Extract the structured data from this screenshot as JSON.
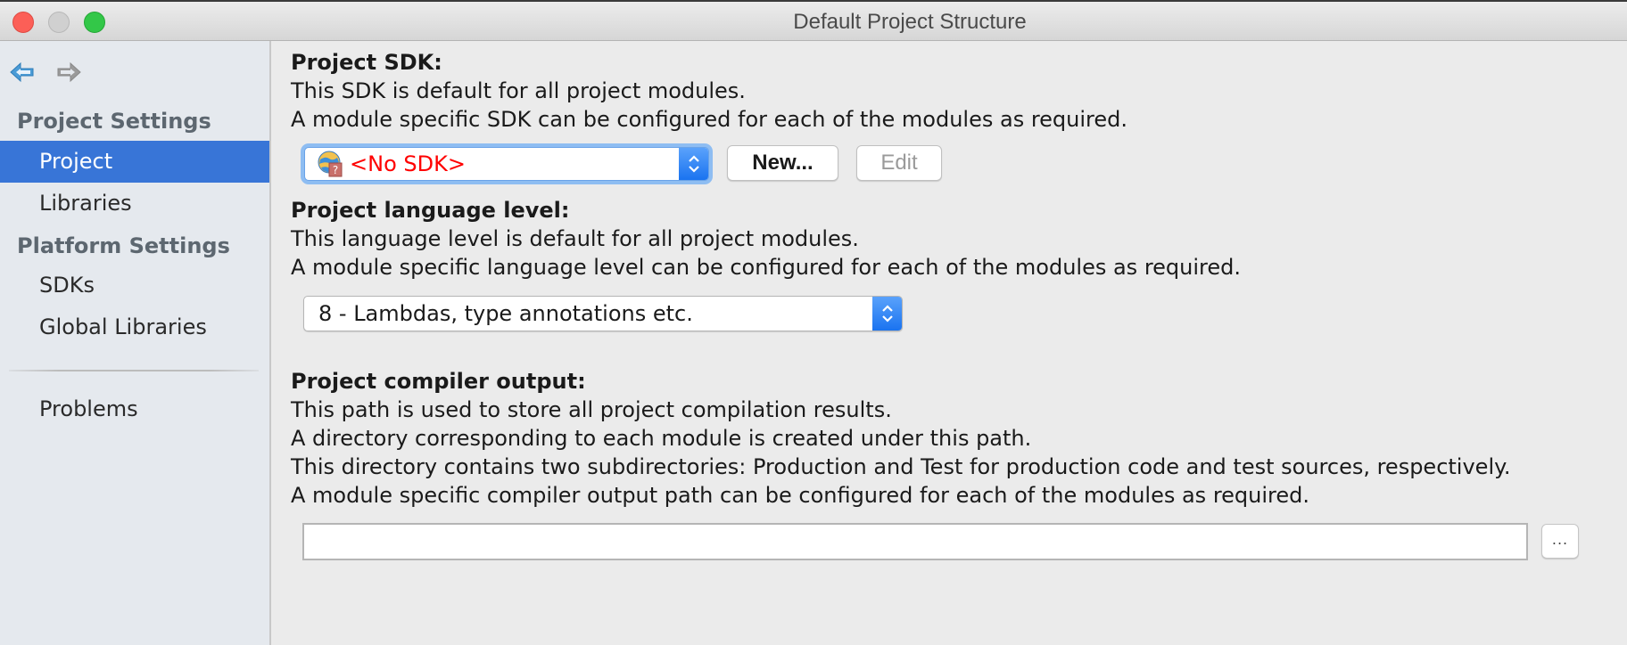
{
  "window": {
    "title": "Default Project Structure",
    "controls": [
      "close",
      "minimize",
      "maximize"
    ]
  },
  "sidebar": {
    "nav": {
      "back_icon": "arrow-left-icon",
      "forward_icon": "arrow-right-icon"
    },
    "groups": [
      {
        "label": "Project Settings"
      },
      {
        "label": "Platform Settings"
      }
    ],
    "items": [
      {
        "label": "Project",
        "selected": true
      },
      {
        "label": "Libraries",
        "selected": false
      },
      {
        "label": "SDKs",
        "selected": false
      },
      {
        "label": "Global Libraries",
        "selected": false
      },
      {
        "label": "Problems",
        "selected": false
      }
    ],
    "selection_color": "#3875d7"
  },
  "main": {
    "sdk": {
      "title": "Project SDK:",
      "lines": [
        "This SDK is default for all project modules.",
        "A module specific SDK can be configured for each of the modules as required."
      ],
      "selected": "<No SDK>",
      "selected_color": "#ff0000",
      "icon": "globe-question-icon",
      "new_label": "New...",
      "edit_label": "Edit"
    },
    "language": {
      "title": "Project language level:",
      "lines": [
        "This language level is default for all project modules.",
        "A module specific language level can be configured for each of the modules as required."
      ],
      "selected": "8 - Lambdas, type annotations etc."
    },
    "compiler": {
      "title": "Project compiler output:",
      "lines": [
        "This path is used to store all project compilation results.",
        "A directory corresponding to each module is created under this path.",
        "This directory contains two subdirectories: Production and Test for production code and test sources, respectively.",
        "A module specific compiler output path can be configured for each of the modules as required."
      ],
      "path_value": "",
      "browse_label": "..."
    }
  }
}
